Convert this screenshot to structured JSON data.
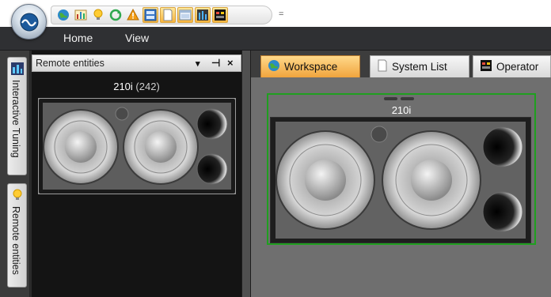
{
  "ribbon": {
    "tabs": [
      "Home",
      "View"
    ]
  },
  "quick_access": {
    "icons": [
      "globe-icon",
      "bar-chart-icon",
      "lightbulb-icon",
      "refresh-icon",
      "warning-icon",
      "panel-icon",
      "document-icon",
      "window-icon",
      "meter-icon",
      "operator-icon"
    ],
    "more": "="
  },
  "side_tabs": [
    "Interactive Tuning",
    "Remote entities"
  ],
  "remote_panel": {
    "title": "Remote entities",
    "controls": [
      "▾",
      "⊣",
      "×"
    ],
    "entity_name": "210i",
    "entity_id": "(242)"
  },
  "doc_tabs": [
    "Workspace",
    "System List",
    "Operator"
  ],
  "workspace": {
    "entity_name": "210i"
  },
  "colors": {
    "selection_outline": "#1f9f1f",
    "active_tab": "#f0a43d"
  }
}
